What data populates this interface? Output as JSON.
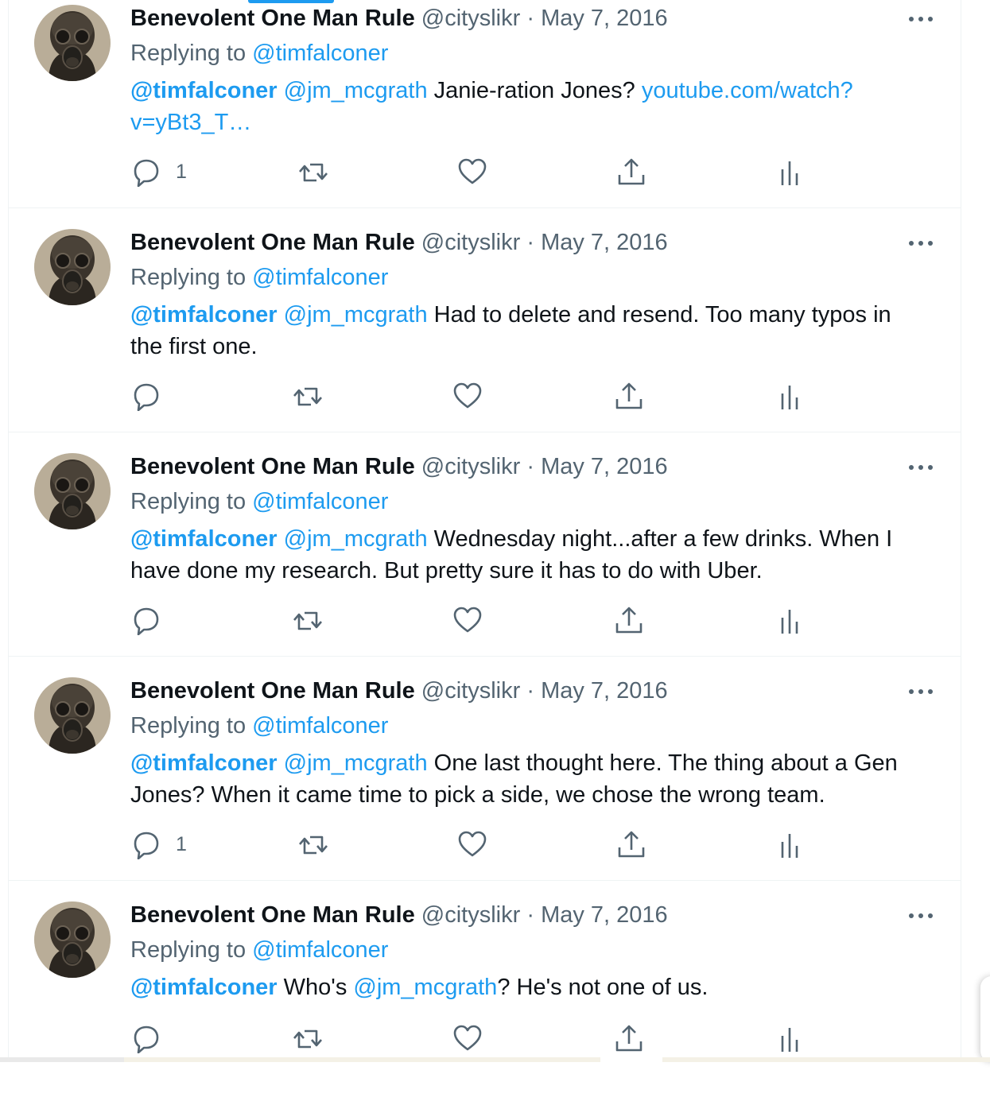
{
  "colors": {
    "link": "#1d9bf0",
    "text": "#0f1419",
    "muted": "#536471",
    "border": "#eff3f4"
  },
  "icons": [
    "reply-icon",
    "retweet-icon",
    "like-icon",
    "share-icon",
    "views-icon",
    "more-icon"
  ],
  "tweets": [
    {
      "name": "Benevolent One Man Rule",
      "handle": "@cityslikr",
      "sep": "·",
      "date": "May 7, 2016",
      "replying_prefix": "Replying to",
      "replying_to": "@timfalconer",
      "m1": "@timfalconer",
      "m2": "@jm_mcgrath",
      "text": " Janie-ration Jones? ",
      "link": "youtube.com/watch?v=yBt3_T…",
      "reply_count": "1"
    },
    {
      "name": "Benevolent One Man Rule",
      "handle": "@cityslikr",
      "sep": "·",
      "date": "May 7, 2016",
      "replying_prefix": "Replying to",
      "replying_to": "@timfalconer",
      "m1": "@timfalconer",
      "m2": "@jm_mcgrath",
      "text": " Had to delete and resend. Too many typos in the first one."
    },
    {
      "name": "Benevolent One Man Rule",
      "handle": "@cityslikr",
      "sep": "·",
      "date": "May 7, 2016",
      "replying_prefix": "Replying to",
      "replying_to": "@timfalconer",
      "m1": "@timfalconer",
      "m2": "@jm_mcgrath",
      "text": " Wednesday night...after a few drinks. When I have done my research. But pretty sure it has to do with Uber."
    },
    {
      "name": "Benevolent One Man Rule",
      "handle": "@cityslikr",
      "sep": "·",
      "date": "May 7, 2016",
      "replying_prefix": "Replying to",
      "replying_to": "@timfalconer",
      "m1": "@timfalconer",
      "m2": "@jm_mcgrath",
      "text": " One last thought here. The thing about a Gen Jones? When it came time to pick a side, we chose the wrong team.",
      "reply_count": "1"
    },
    {
      "name": "Benevolent One Man Rule",
      "handle": "@cityslikr",
      "sep": "·",
      "date": "May 7, 2016",
      "replying_prefix": "Replying to",
      "replying_to": "@timfalconer",
      "m1": "@timfalconer",
      "text_a": " Who's ",
      "m2": "@jm_mcgrath",
      "text_b": "? He's not one of us."
    }
  ]
}
